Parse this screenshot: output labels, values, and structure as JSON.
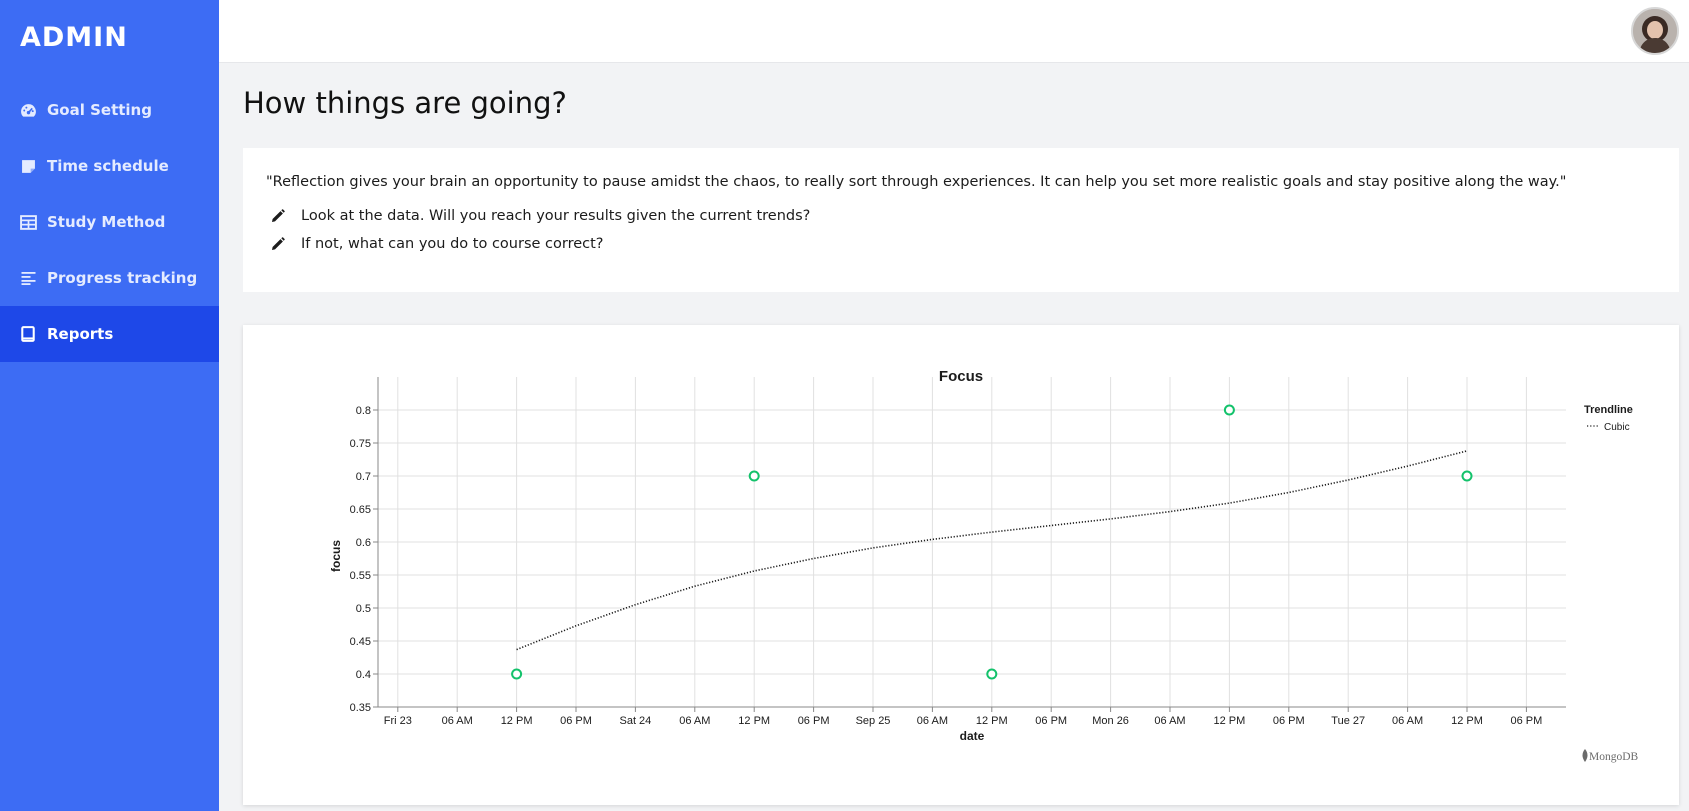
{
  "sidebar": {
    "brand": "ADMIN",
    "items": [
      {
        "label": "Goal Setting",
        "icon": "speedometer-icon"
      },
      {
        "label": "Time schedule",
        "icon": "note-icon"
      },
      {
        "label": "Study Method",
        "icon": "table-icon"
      },
      {
        "label": "Progress tracking",
        "icon": "align-left-icon"
      },
      {
        "label": "Reports",
        "icon": "tablet-icon",
        "active": true
      }
    ]
  },
  "header": {
    "avatar": "user-avatar"
  },
  "main": {
    "title": "How things are going?",
    "quote": "\"Reflection gives your brain an opportunity to pause amidst the chaos, to really sort through experiences. It can help you set more realistic goals and stay positive along the way.\"",
    "tips": [
      "Look at the data. Will you reach your results given the current trends?",
      "If not, what can you do to course correct?"
    ]
  },
  "chart_data": {
    "type": "scatter",
    "title": "Focus",
    "xlabel": "date",
    "ylabel": "focus",
    "x_tick_labels": [
      "Fri 23",
      "06 AM",
      "12 PM",
      "06 PM",
      "Sat 24",
      "06 AM",
      "12 PM",
      "06 PM",
      "Sep 25",
      "06 AM",
      "12 PM",
      "06 PM",
      "Mon 26",
      "06 AM",
      "12 PM",
      "06 PM",
      "Tue 27",
      "06 AM",
      "12 PM",
      "06 PM"
    ],
    "y_ticks": [
      "0.35",
      "0.4",
      "0.45",
      "0.5",
      "0.55",
      "0.6",
      "0.65",
      "0.7",
      "0.75",
      "0.8"
    ],
    "ylim": [
      0.35,
      0.85
    ],
    "xlim": [
      "Sep 22 22:00",
      "Sep 27 22:00"
    ],
    "grid": true,
    "points": [
      {
        "x": "Sep 23 12:00",
        "y": 0.4
      },
      {
        "x": "Sep 24 12:00",
        "y": 0.7
      },
      {
        "x": "Sep 25 12:00",
        "y": 0.4
      },
      {
        "x": "Sep 26 12:00",
        "y": 0.8
      },
      {
        "x": "Sep 27 12:00",
        "y": 0.7
      }
    ],
    "trendline": {
      "name": "Cubic",
      "samples": [
        {
          "x": "Sep 23 12:00",
          "y": 0.437
        },
        {
          "x": "Sep 23 18:00",
          "y": 0.473
        },
        {
          "x": "Sep 24 00:00",
          "y": 0.505
        },
        {
          "x": "Sep 24 06:00",
          "y": 0.533
        },
        {
          "x": "Sep 24 12:00",
          "y": 0.556
        },
        {
          "x": "Sep 24 18:00",
          "y": 0.575
        },
        {
          "x": "Sep 25 00:00",
          "y": 0.591
        },
        {
          "x": "Sep 25 06:00",
          "y": 0.604
        },
        {
          "x": "Sep 25 12:00",
          "y": 0.615
        },
        {
          "x": "Sep 25 18:00",
          "y": 0.625
        },
        {
          "x": "Sep 26 00:00",
          "y": 0.635
        },
        {
          "x": "Sep 26 06:00",
          "y": 0.646
        },
        {
          "x": "Sep 26 12:00",
          "y": 0.659
        },
        {
          "x": "Sep 26 18:00",
          "y": 0.675
        },
        {
          "x": "Sep 27 00:00",
          "y": 0.694
        },
        {
          "x": "Sep 27 06:00",
          "y": 0.715
        },
        {
          "x": "Sep 27 12:00",
          "y": 0.738
        }
      ]
    },
    "legend": {
      "title": "Trendline",
      "entries": [
        "Cubic"
      ],
      "placement": "top-right"
    },
    "watermark": "MongoDB",
    "colors": {
      "point": "#13c26b",
      "trendline": "#1c1c1c",
      "grid": "#e0e0e0"
    }
  }
}
